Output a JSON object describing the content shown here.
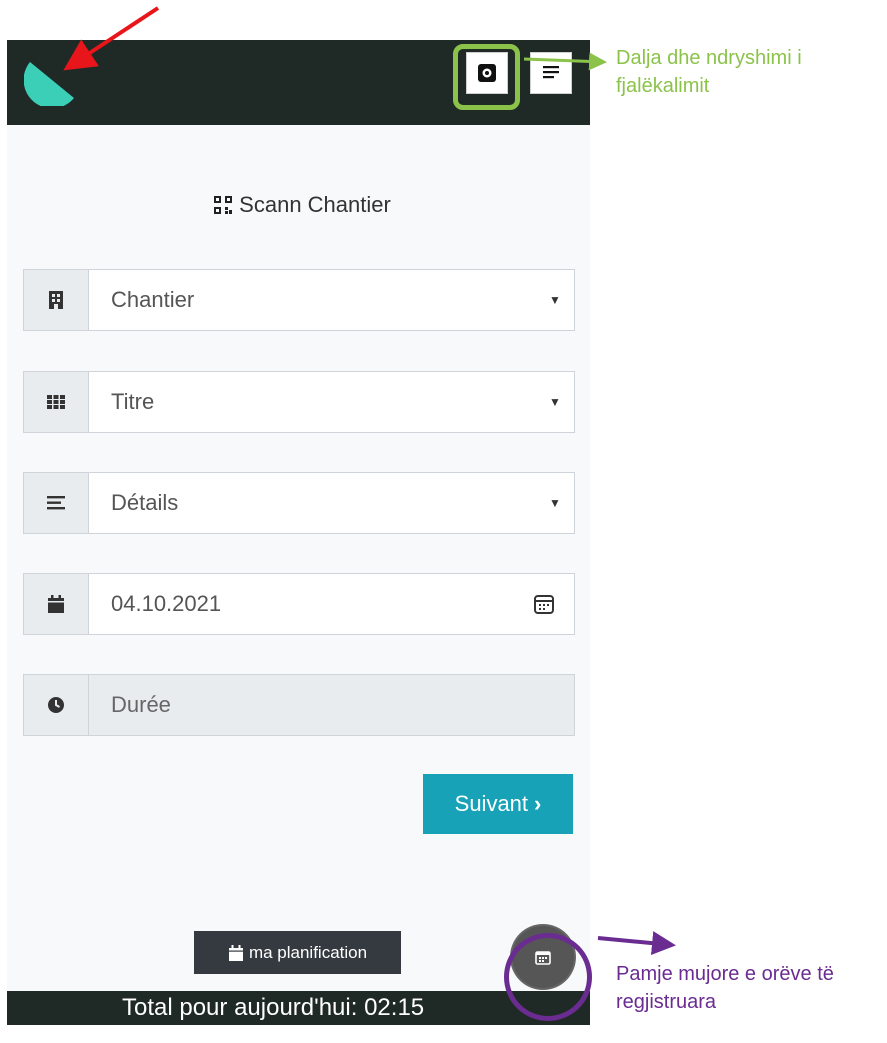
{
  "header": {
    "logo_icon": "teal-half-circle-logo",
    "settings_icon": "settings-icon",
    "menu_icon": "menu-icon"
  },
  "scan_button": {
    "label": "Scann Chantier",
    "icon": "qr-code-icon"
  },
  "form": {
    "fields": [
      {
        "icon": "building-icon",
        "value": "Chantier",
        "type": "select"
      },
      {
        "icon": "grid-icon",
        "value": "Titre",
        "type": "select"
      },
      {
        "icon": "align-left-icon",
        "value": "Détails",
        "type": "select"
      },
      {
        "icon": "calendar-icon",
        "value": "04.10.2021",
        "type": "date"
      },
      {
        "icon": "clock-icon",
        "value": "Durée",
        "type": "disabled"
      }
    ],
    "next_button": "Suivant"
  },
  "planning_button": "ma planification",
  "footer": {
    "total_text": "Total pour aujourd'hui: 02:15"
  },
  "annotations": {
    "green_note": "Dalja dhe ndryshimi i fjalëkalimit",
    "purple_note": "Pamje mujore e orëve të regjistruara"
  },
  "colors": {
    "header": "#1f2a26",
    "accent": "#17a2b8",
    "logo": "#3ccfb8",
    "annotation_green": "#8bc34a",
    "annotation_purple": "#6a2c91",
    "annotation_red": "#e8151b"
  }
}
